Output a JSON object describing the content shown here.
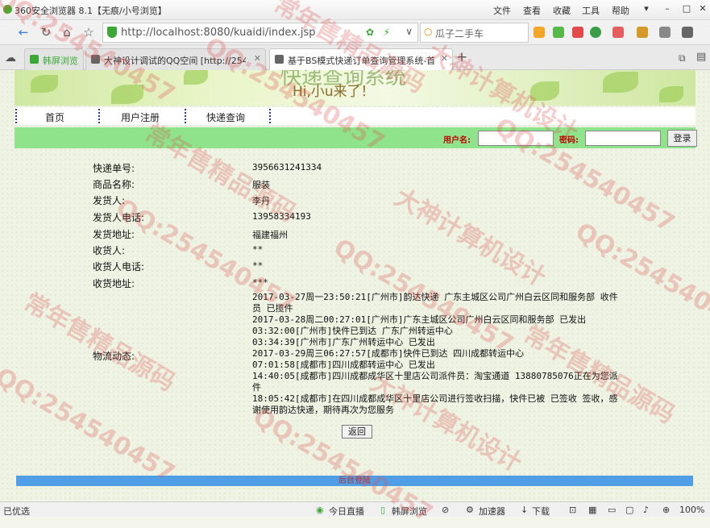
{
  "window": {
    "title": "360安全浏览器 8.1【无痕/小号浏览】",
    "menu": [
      "文件",
      "查看",
      "收藏",
      "工具",
      "帮助"
    ]
  },
  "address_bar": {
    "url": "http://localhost:8080/kuaidi/index.jsp",
    "search_placeholder": "瓜子二手车"
  },
  "tabs": [
    {
      "label": "韩屏浏览",
      "active": false
    },
    {
      "label": "大神设计调试的QQ空间 [http://2545...",
      "active": false
    },
    {
      "label": "基于BS模式快递订单查询管理系统-首...",
      "active": true
    }
  ],
  "banner": {
    "title": "快递查询系统",
    "subtitle": "Hi,小u来了！"
  },
  "nav": [
    "首页",
    "用户注册",
    "快递查询"
  ],
  "login": {
    "username_label": "用户名:",
    "password_label": "密码:",
    "button": "登录"
  },
  "details": [
    {
      "label": "快递单号:",
      "value": "3956631241334"
    },
    {
      "label": "商品名称:",
      "value": "服装"
    },
    {
      "label": "发货人:",
      "value": "李丹"
    },
    {
      "label": "发货人电话:",
      "value": "13958334193"
    },
    {
      "label": "发货地址:",
      "value": "福建福州"
    },
    {
      "label": "收货人:",
      "value": "**"
    },
    {
      "label": "收货人电话:",
      "value": "**"
    },
    {
      "label": "收货地址:",
      "value": "***"
    }
  ],
  "logistics": {
    "label": "物流动态:",
    "lines": [
      "2017-03-27周一23:50:21[广州市]韵达快递 广东主城区公司广州白云区同和服务部 收件员 已揽件",
      "2017-03-28周二00:27:01[广州市]广东主城区公司广州白云区同和服务部 已发出",
      "03:32:00[广州市]快件已到达 广东广州转运中心",
      "03:34:39[广州市]广东广州转运中心 已发出",
      "2017-03-29周三06:27:57[成都市]快件已到达 四川成都转运中心",
      "07:01:58[成都市]四川成都转运中心 已发出",
      "14:40:05[成都市]四川成都成华区十里店公司派件员：淘宝通道 13880785076正在为您派件",
      "18:05:42[成都市]在四川成都成华区十里店公司进行签收扫描，快件已被 已签收 签收，感谢使用韵达快递，期待再次为您服务"
    ]
  },
  "back_button": "返回",
  "footer": "后台登陆",
  "statusbar": {
    "left": "已优选",
    "items": [
      "今日直播",
      "韩屏浏览",
      "加速器",
      "下载",
      "100%"
    ]
  },
  "watermarks": [
    "常年售精品源码",
    "QQ:254540457",
    "大神计算机设计"
  ]
}
